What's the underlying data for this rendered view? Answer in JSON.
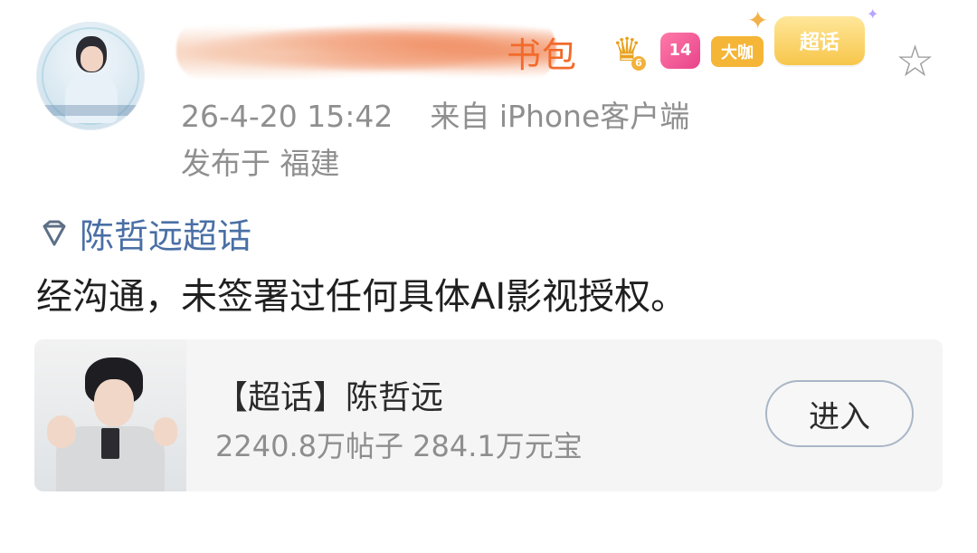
{
  "header": {
    "username_visible_suffix": "书包",
    "timestamp": "26-4-20 15:42",
    "source": "来自 iPhone客户端",
    "location": "发布于 福建",
    "badges": {
      "crown_level": "6",
      "vip": "14",
      "daka": "大咖",
      "chaohua": "超话"
    },
    "star_icon": "star-outline-icon"
  },
  "post": {
    "topic_link": "陈哲远超话",
    "text": "经沟通，未签署过任何具体AI影视授权。"
  },
  "topic_card": {
    "title": "【超话】陈哲远",
    "stats": "2240.8万帖子 284.1万元宝",
    "enter_label": "进入"
  }
}
